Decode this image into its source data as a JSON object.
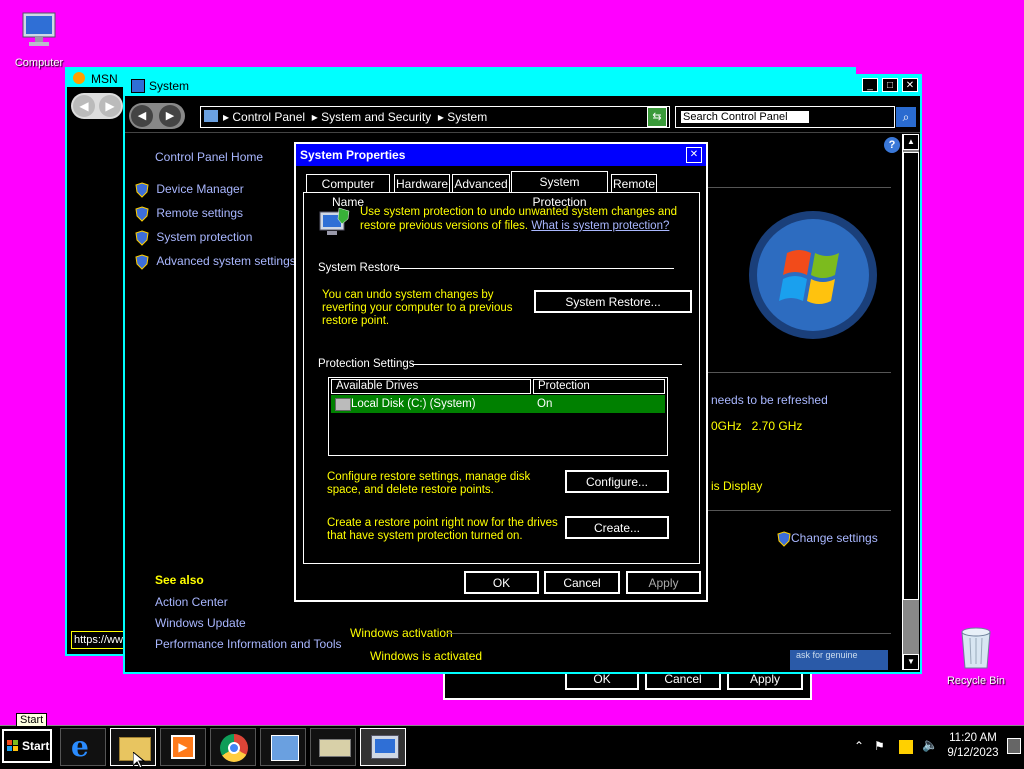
{
  "desktop": {
    "computer_label": "Computer",
    "recycle_label": "Recycle Bin"
  },
  "msn_window": {
    "title": "MSN",
    "url_fragment": "https://ww"
  },
  "back_dialog": {
    "ok": "OK",
    "cancel": "Cancel",
    "apply": "Apply"
  },
  "system_window": {
    "title": "System",
    "breadcrumb": [
      "Control Panel",
      "System and Security",
      "System"
    ],
    "search_placeholder": "Search Control Panel",
    "sidebar": {
      "home": "Control Panel Home",
      "items": [
        "Device Manager",
        "Remote settings",
        "System protection",
        "Advanced system settings"
      ],
      "see_also": "See also",
      "see_also_items": [
        "Action Center",
        "Windows Update",
        "Performance Information and Tools"
      ]
    },
    "fragments": {
      "refresh": "needs to be refreshed",
      "ghz": "0GHz   2.70 GHz",
      "display": "is Display",
      "change_settings": "Change settings",
      "activation_header": "Windows activation",
      "activation_status": "Windows is activated",
      "genuine": "ask for genuine"
    }
  },
  "dialog": {
    "title": "System Properties",
    "tabs": [
      "Computer Name",
      "Hardware",
      "Advanced",
      "System Protection",
      "Remote"
    ],
    "active_tab": "System Protection",
    "intro": "Use system protection to undo unwanted system changes and restore previous versions of files.",
    "intro_link": "What is system protection?",
    "restore_section": "System Restore",
    "restore_text": "You can undo system changes by reverting your computer to a previous restore point.",
    "restore_button": "System Restore...",
    "protection_section": "Protection Settings",
    "columns": [
      "Available Drives",
      "Protection"
    ],
    "drives": [
      {
        "name": "Local Disk (C:) (System)",
        "protection": "On"
      }
    ],
    "configure_text": "Configure restore settings, manage disk space, and delete restore points.",
    "configure_button": "Configure...",
    "create_text": "Create a restore point right now for the drives that have system protection turned on.",
    "create_button": "Create...",
    "ok": "OK",
    "cancel": "Cancel",
    "apply": "Apply"
  },
  "taskbar": {
    "tooltip": "Start",
    "start": "Start",
    "time": "11:20 AM",
    "date": "9/12/2023"
  },
  "colors": {
    "desktop": "#ff00ff",
    "chrome": "#00ffff",
    "dialog_title": "#0000ff",
    "selection": "#008000",
    "link": "#a9b7ff"
  }
}
